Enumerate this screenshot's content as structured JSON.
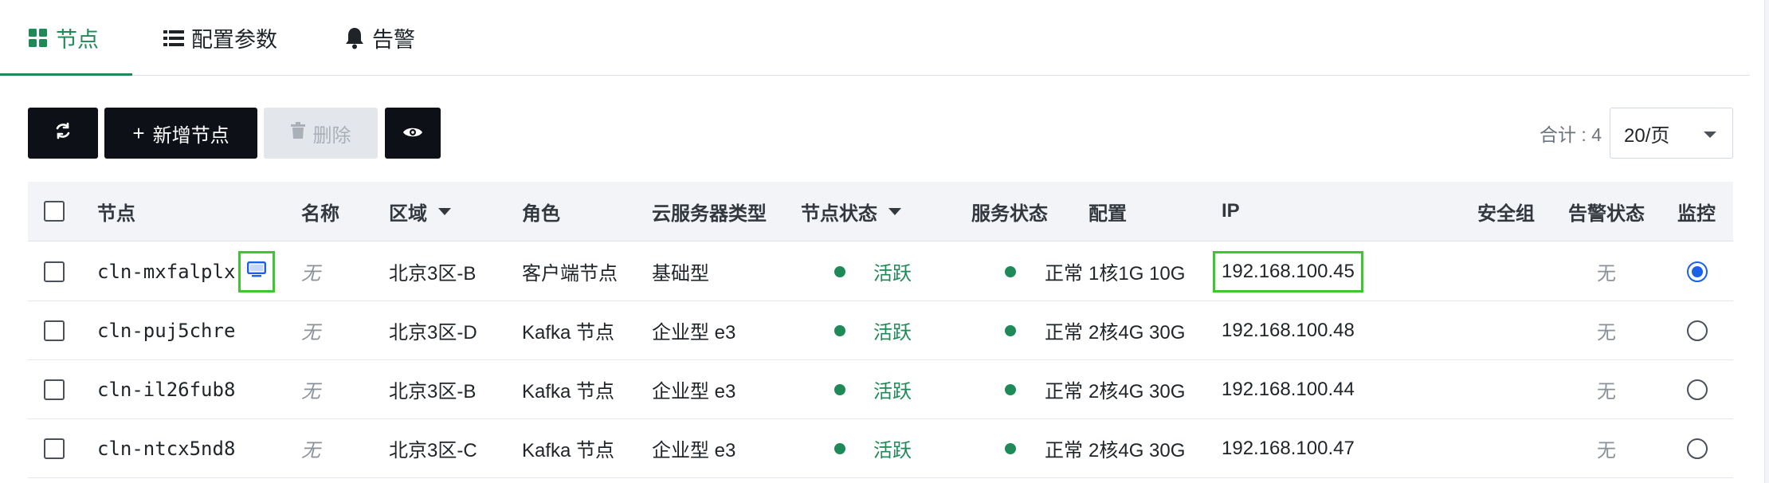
{
  "tabs": [
    {
      "label": "节点",
      "icon": "grid-icon",
      "active": true
    },
    {
      "label": "配置参数",
      "icon": "list-icon",
      "active": false
    },
    {
      "label": "告警",
      "icon": "bell-icon",
      "active": false
    }
  ],
  "toolbar": {
    "refresh_icon": "refresh-icon",
    "add_label": "新增节点",
    "delete_label": "删除",
    "view_icon": "eye-icon"
  },
  "pagination": {
    "total_label": "合计 : 4",
    "page_size": "20/页"
  },
  "table": {
    "headers": [
      "节点",
      "名称",
      "区域",
      "角色",
      "云服务器类型",
      "节点状态",
      "服务状态",
      "配置",
      "IP",
      "安全组",
      "告警状态",
      "监控"
    ],
    "rows": [
      {
        "node": "cln-mxfalplx",
        "name": "无",
        "zone": "北京3区-B",
        "role": "客户端节点",
        "type": "基础型",
        "node_status": "活跃",
        "service_status": "正常",
        "config": "1核1G 10G",
        "ip": "192.168.100.45",
        "security_group": "",
        "alert_status": "无",
        "monitor": true,
        "has_vnc": true
      },
      {
        "node": "cln-puj5chre",
        "name": "无",
        "zone": "北京3区-D",
        "role": "Kafka 节点",
        "type": "企业型 e3",
        "node_status": "活跃",
        "service_status": "正常",
        "config": "2核4G 30G",
        "ip": "192.168.100.48",
        "security_group": "",
        "alert_status": "无",
        "monitor": false,
        "has_vnc": false
      },
      {
        "node": "cln-il26fub8",
        "name": "无",
        "zone": "北京3区-B",
        "role": "Kafka 节点",
        "type": "企业型 e3",
        "node_status": "活跃",
        "service_status": "正常",
        "config": "2核4G 30G",
        "ip": "192.168.100.44",
        "security_group": "",
        "alert_status": "无",
        "monitor": false,
        "has_vnc": false
      },
      {
        "node": "cln-ntcx5nd8",
        "name": "无",
        "zone": "北京3区-C",
        "role": "Kafka 节点",
        "type": "企业型 e3",
        "node_status": "活跃",
        "service_status": "正常",
        "config": "2核4G 30G",
        "ip": "192.168.100.47",
        "security_group": "",
        "alert_status": "无",
        "monitor": false,
        "has_vnc": false
      }
    ]
  },
  "colors": {
    "accent": "#1e8a57",
    "highlight": "#3ec52f",
    "radio_selected": "#1b62e8",
    "dark_button": "#0d1117"
  }
}
